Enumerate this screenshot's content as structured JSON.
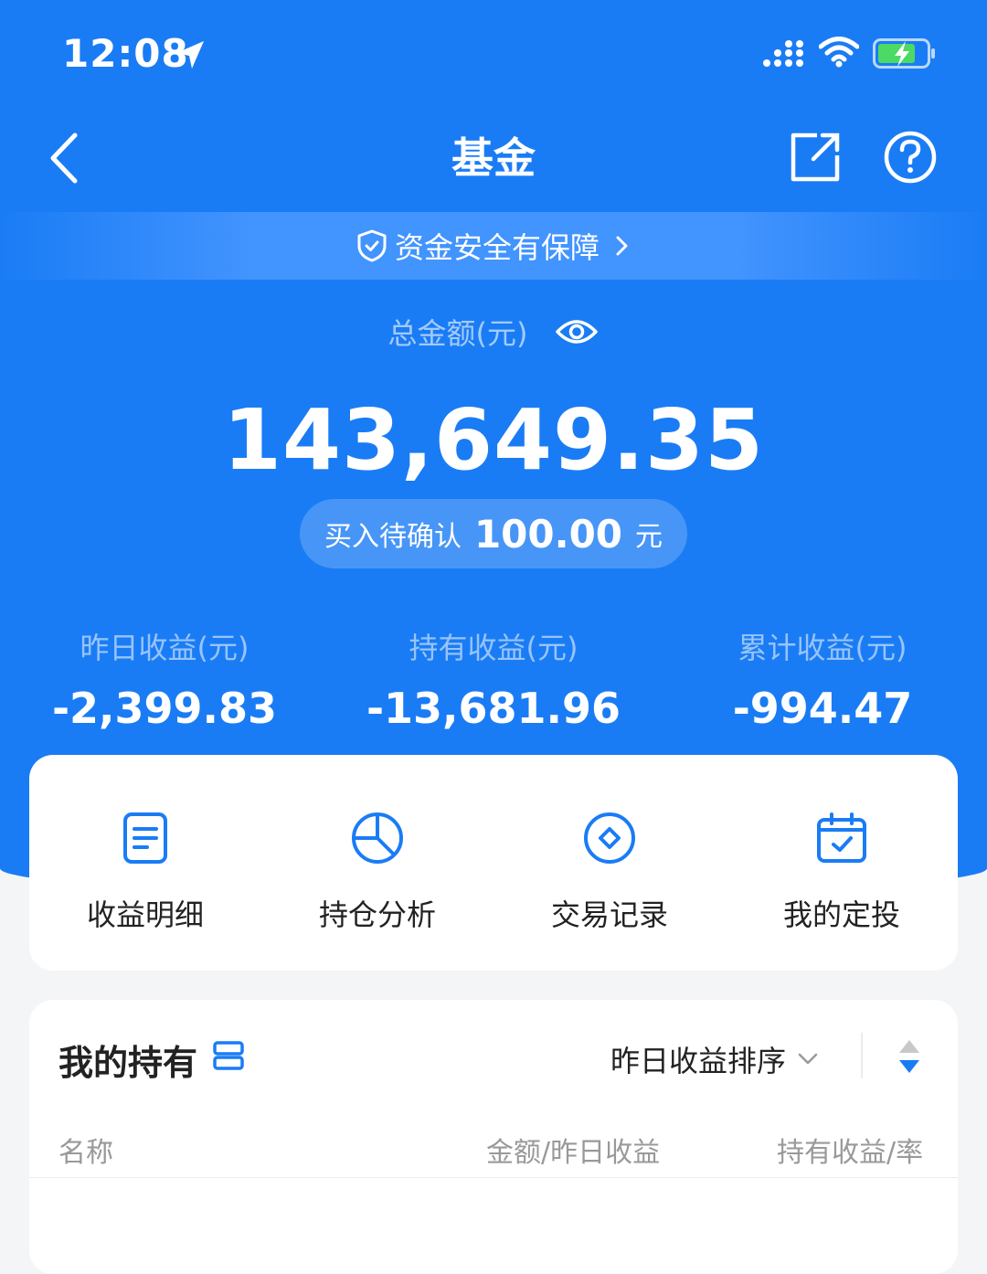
{
  "status_bar": {
    "time": "12:08",
    "icons": [
      "location-arrow-icon",
      "signal-icon",
      "wifi-icon",
      "battery-charging-icon"
    ]
  },
  "nav": {
    "title": "基金",
    "icons": [
      "back-chevron-icon",
      "share-icon",
      "help-icon"
    ]
  },
  "security_banner": {
    "text": "资金安全有保障"
  },
  "total": {
    "label": "总金额(元)",
    "amount": "143,649.35",
    "pending_label": "买入待确认",
    "pending_value": "100.00",
    "pending_unit": "元"
  },
  "stats": [
    {
      "label": "昨日收益(元)",
      "value": "-2,399.83"
    },
    {
      "label": "持有收益(元)",
      "value": "-13,681.96"
    },
    {
      "label": "累计收益(元)",
      "value": "-994.47"
    }
  ],
  "actions": [
    {
      "label": "收益明细",
      "icon": "document-icon"
    },
    {
      "label": "持仓分析",
      "icon": "pie-chart-icon"
    },
    {
      "label": "交易记录",
      "icon": "diamond-circle-icon"
    },
    {
      "label": "我的定投",
      "icon": "calendar-check-icon"
    }
  ],
  "holdings": {
    "title": "我的持有",
    "sort_label": "昨日收益排序",
    "columns": [
      "名称",
      "金额/昨日收益",
      "持有收益/率"
    ]
  },
  "colors": {
    "primary_blue": "#1a7cf5",
    "background": "#f4f5f7",
    "card": "#ffffff"
  }
}
